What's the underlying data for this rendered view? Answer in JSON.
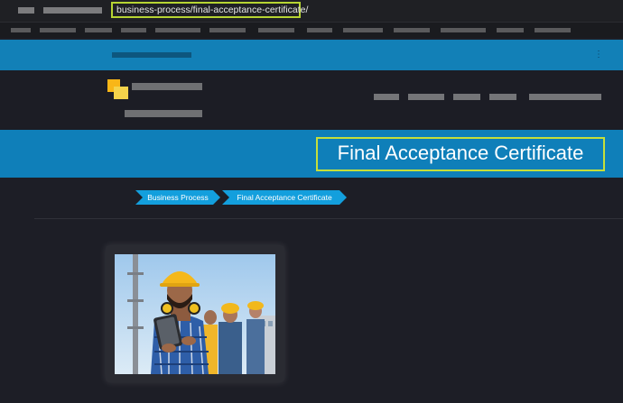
{
  "browser": {
    "url_fragment": "business-process/final-acceptance-certificate/"
  },
  "banner": {
    "title": "Final Acceptance Certificate"
  },
  "breadcrumb": {
    "items": [
      "Business Process",
      "Final Acceptance Certificate"
    ]
  },
  "colors": {
    "banner_blue": "#0f7fb9",
    "crumb_blue": "#139fdd",
    "highlight_green": "#c6df3a",
    "page_bg": "#1d1e26"
  },
  "card": {
    "image_subject": "construction-workers-with-tablet"
  }
}
